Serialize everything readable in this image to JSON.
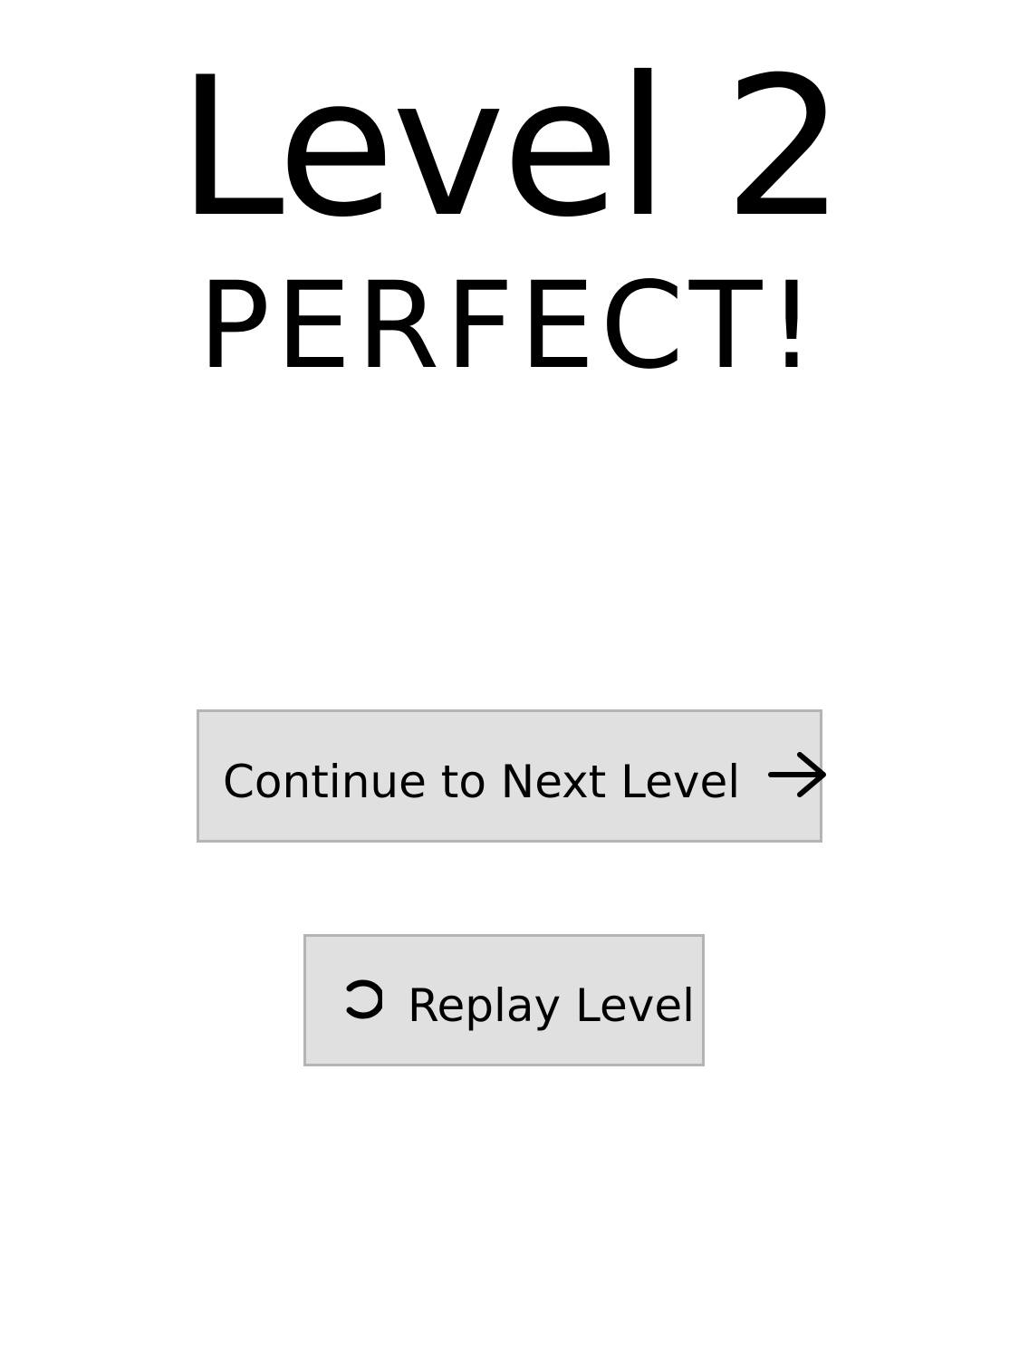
{
  "header": {
    "level_title": "Level 2",
    "result": "PERFECT!"
  },
  "actions": {
    "continue_label": "Continue to Next Level",
    "continue_icon": "arrow-right-icon",
    "replay_label": "Replay Level",
    "replay_icon": "replay-icon"
  },
  "colors": {
    "background": "#ffffff",
    "button_fill": "#e0e0e0",
    "button_border": "#b4b4b4",
    "text": "#000000"
  }
}
